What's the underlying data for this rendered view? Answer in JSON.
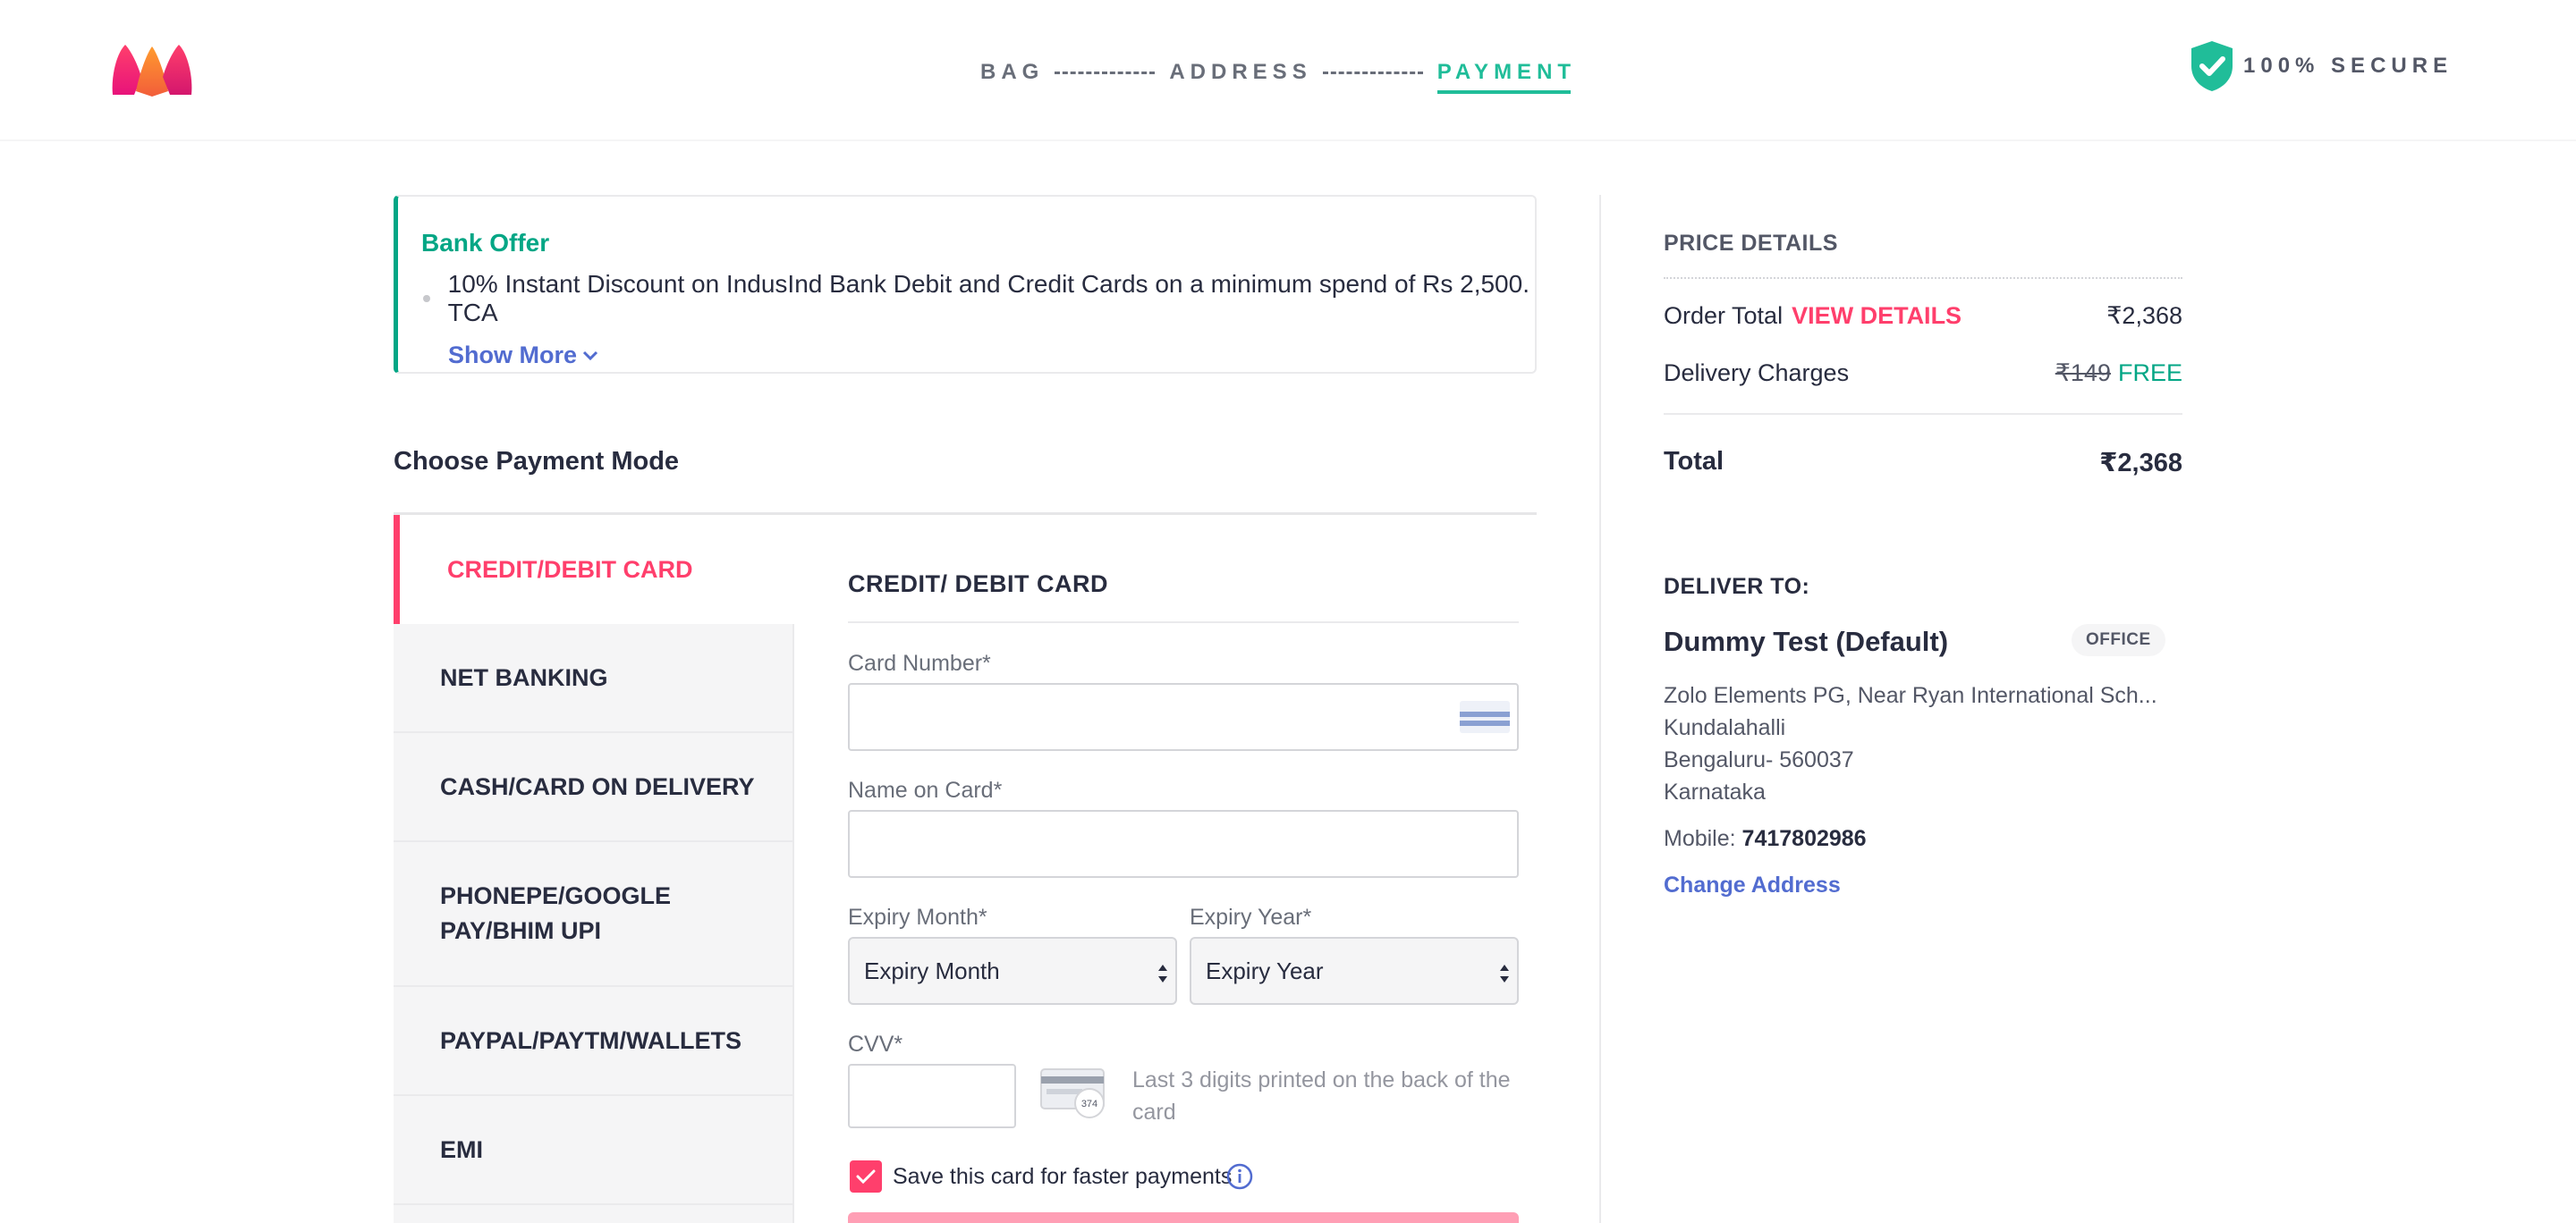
{
  "header": {
    "logo_name": "myntra-logo",
    "steps": [
      {
        "label": "BAG",
        "active": false
      },
      {
        "label": "ADDRESS",
        "active": false
      },
      {
        "label": "PAYMENT",
        "active": true
      }
    ],
    "secure_text": "100% SECURE",
    "secure_icon": "shield-check-icon"
  },
  "bank_offer": {
    "title": "Bank Offer",
    "item": "10% Instant Discount on IndusInd Bank Debit and Credit Cards on a minimum spend of Rs 2,500. TCA",
    "show_more": "Show More"
  },
  "payment": {
    "title": "Choose Payment Mode",
    "modes": [
      "CREDIT/DEBIT CARD",
      "NET BANKING",
      "CASH/CARD ON DELIVERY",
      "PHONEPE/GOOGLE PAY/BHIM UPI",
      "PAYPAL/PAYTM/WALLETS",
      "EMI"
    ],
    "active_mode_index": 0
  },
  "card_form": {
    "title": "CREDIT/ DEBIT CARD",
    "card_number_label": "Card Number*",
    "card_number_value": "",
    "name_label": "Name on Card*",
    "name_value": "",
    "expiry_month_label": "Expiry Month*",
    "expiry_month_value": "Expiry Month",
    "expiry_year_label": "Expiry Year*",
    "expiry_year_value": "Expiry Year",
    "cvv_label": "CVV*",
    "cvv_value": "",
    "cvv_hint": "Last 3 digits printed on the back of the card",
    "cvv_card_digits": "374",
    "save_card_label": "Save this card for faster payments",
    "save_card_checked": true
  },
  "price_details": {
    "title": "PRICE DETAILS",
    "order_total_label": "Order Total",
    "view_details": "VIEW DETAILS",
    "order_total_value": "₹2,368",
    "delivery_label": "Delivery Charges",
    "delivery_original": "₹149",
    "delivery_free": "FREE",
    "total_label": "Total",
    "total_value": "₹2,368"
  },
  "delivery": {
    "title": "DELIVER TO:",
    "name": "Dummy Test (Default)",
    "badge": "OFFICE",
    "address_lines": [
      "Zolo Elements PG, Near Ryan International Sch...",
      "Kundalahalli",
      "Bengaluru- 560037",
      "Karnataka"
    ],
    "mobile_label": "Mobile:",
    "mobile_value": "7417802986",
    "change_address": "Change Address"
  },
  "colors": {
    "brand_pink": "#ff3f6c",
    "success_green": "#03a685",
    "step_active": "#20bd99",
    "link_blue": "#526cd0"
  }
}
